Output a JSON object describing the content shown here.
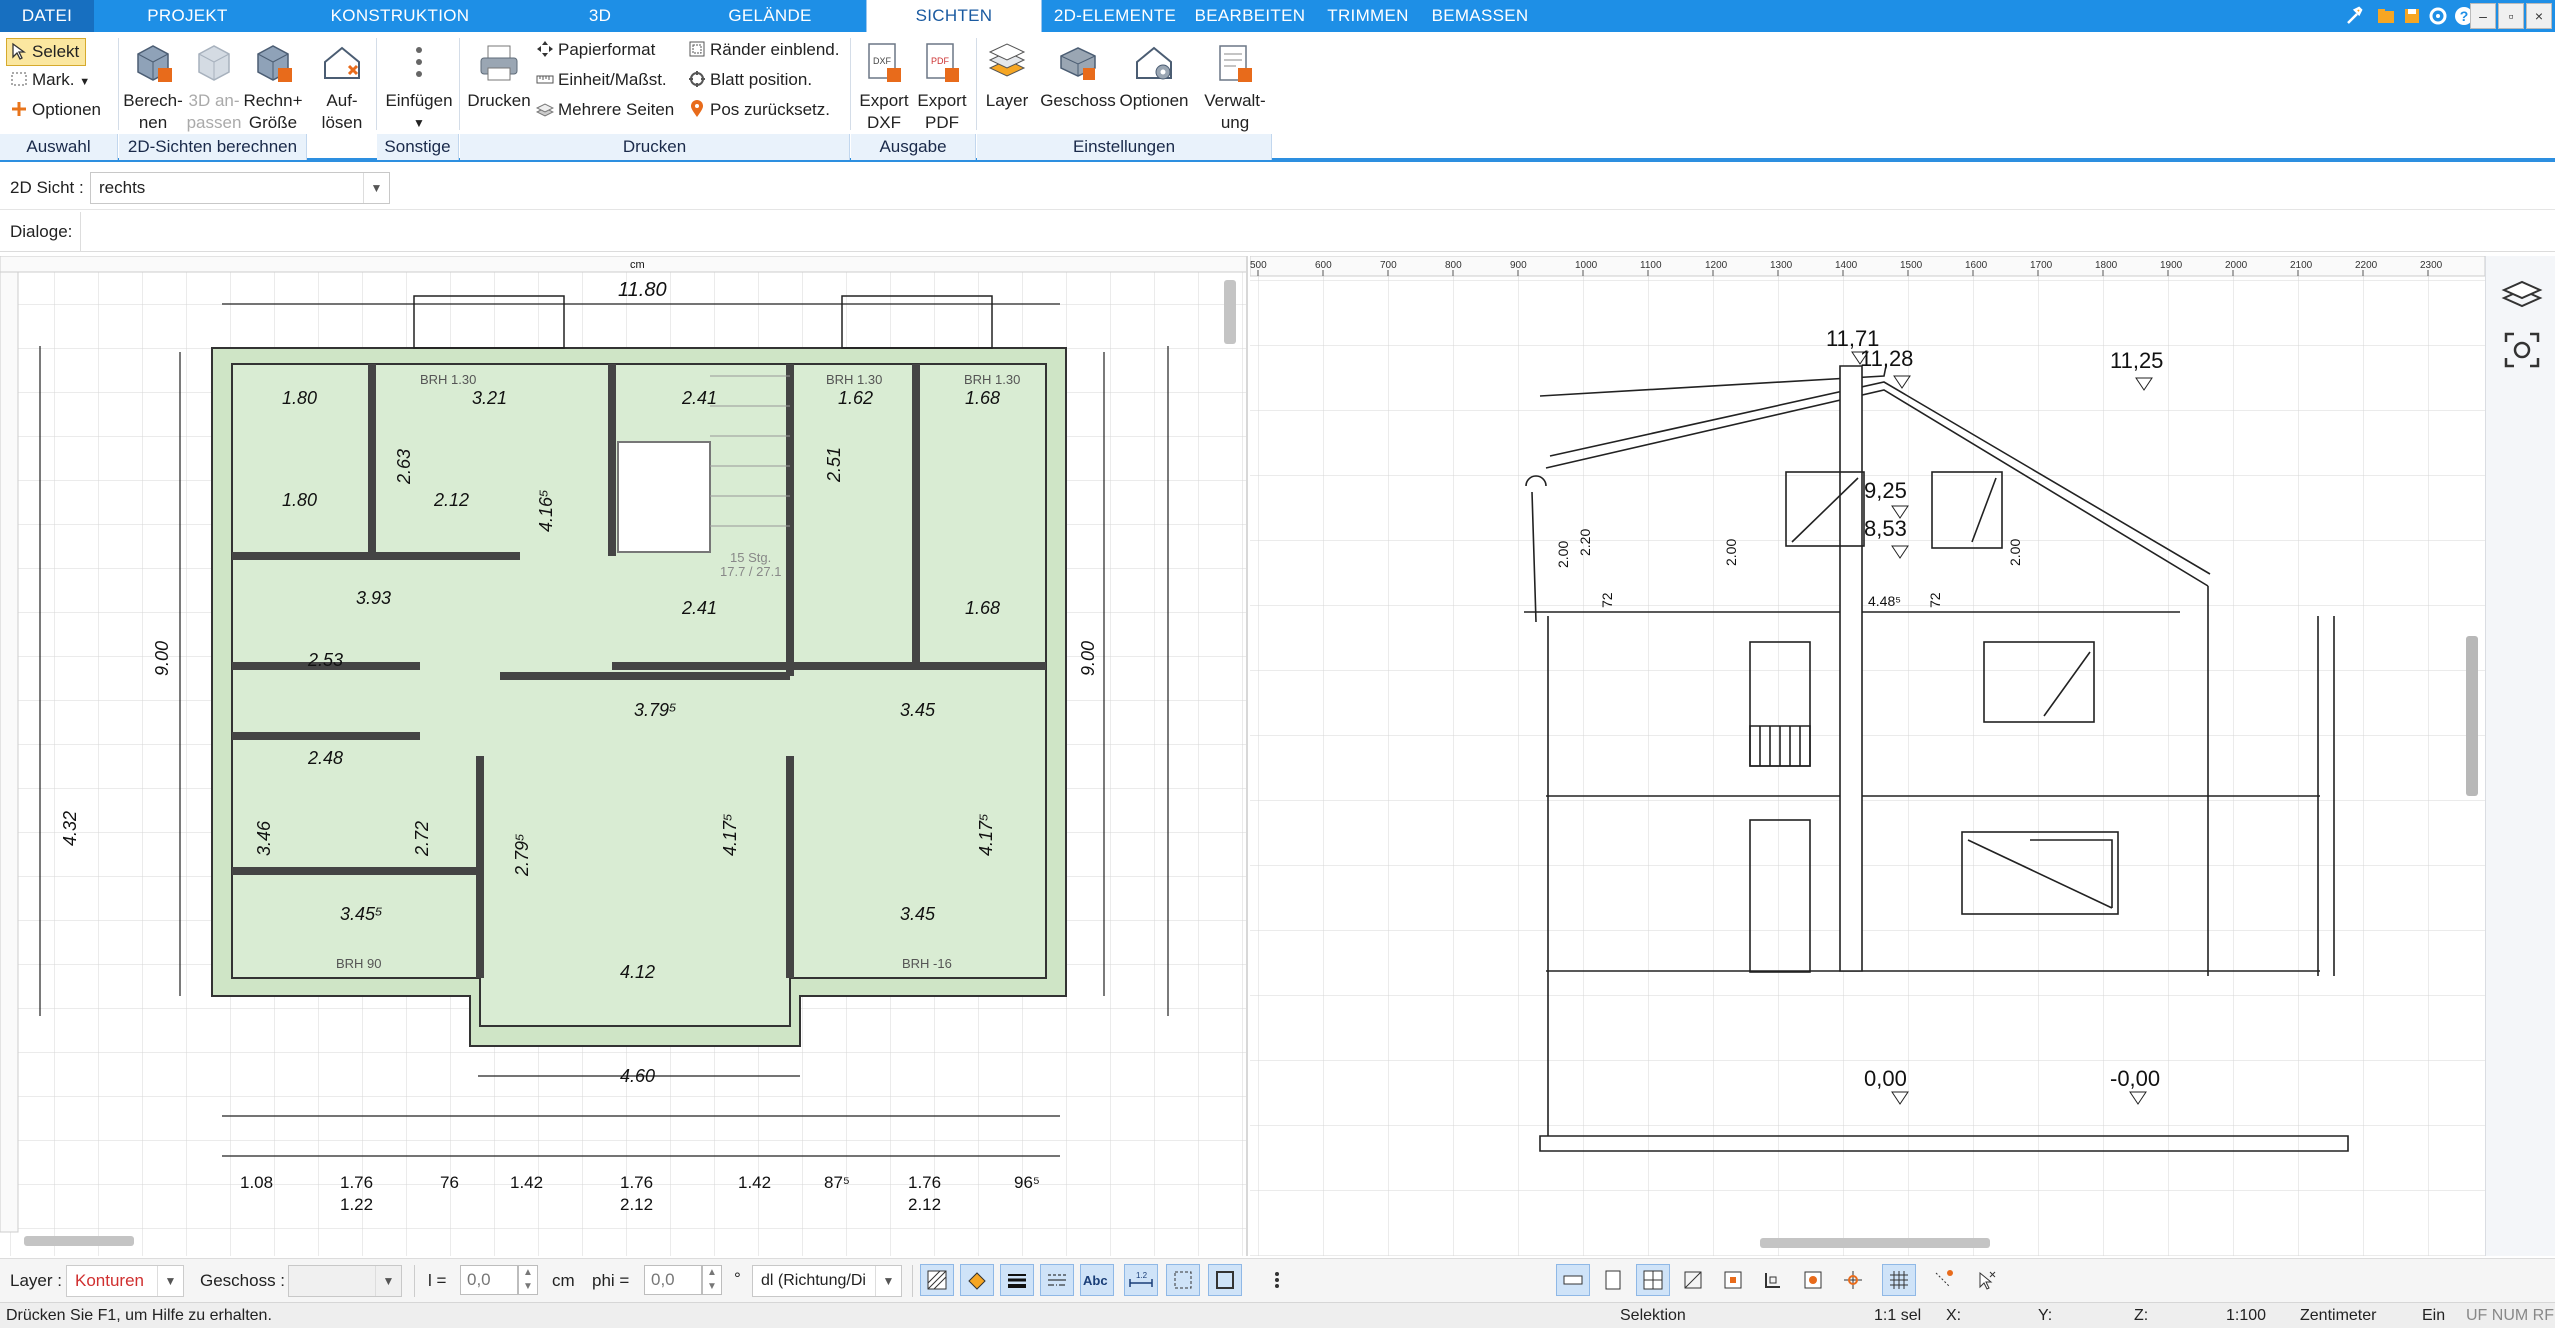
{
  "menu": {
    "tabs": [
      "DATEI",
      "PROJEKT",
      "KONSTRUKTION",
      "3D",
      "GELÄNDE",
      "SICHTEN",
      "2D-ELEMENTE",
      "BEARBEITEN",
      "TRIMMEN",
      "BEMASSEN"
    ],
    "active_tab": "SICHTEN"
  },
  "ribbon": {
    "auswahl": {
      "selekt": "Selekt",
      "mark": "Mark.",
      "optionen": "Optionen",
      "label": "Auswahl"
    },
    "sichten": {
      "berechnen": [
        "Berech-",
        "nen"
      ],
      "anpassen": [
        "3D an-",
        "passen"
      ],
      "rechn_groesse": [
        "Rechn+",
        "Größe"
      ],
      "label": "2D-Sichten berechnen"
    },
    "aufloesen": [
      "Auf-",
      "lösen"
    ],
    "sonstige": {
      "einfuegen": "Einfügen",
      "label": "Sonstige"
    },
    "drucken": {
      "drucken": "Drucken",
      "papierformat": "Papierformat",
      "einheit": "Einheit/Maßst.",
      "mehrere": "Mehrere Seiten",
      "raender": "Ränder einblend.",
      "blatt": "Blatt position.",
      "pos": "Pos zurücksetz.",
      "label": "Drucken"
    },
    "ausgabe": {
      "dxf": [
        "Export",
        "DXF"
      ],
      "pdf": [
        "Export",
        "PDF"
      ],
      "label": "Ausgabe"
    },
    "einstellungen": {
      "layer": "Layer",
      "geschoss": "Geschoss",
      "optionen": "Optionen",
      "verwaltung": [
        "Verwalt-",
        "ung"
      ],
      "label": "Einstellungen"
    }
  },
  "sicht": {
    "label": "2D Sicht :",
    "value": "rechts"
  },
  "dialoge": {
    "label": "Dialoge:"
  },
  "floorplan": {
    "unit": "cm",
    "dims_top": [
      "11.80"
    ],
    "dims_bottom": [
      "1.08",
      "1.76",
      "76",
      "1.42",
      "1.76",
      "1.42",
      "87⁵",
      "1.76",
      "96⁵"
    ],
    "dims_bottom2": [
      "1.22",
      "2.12",
      "2.12"
    ],
    "room_dims": [
      "1.80",
      "3.21",
      "2.41",
      "1.62",
      "1.68",
      "2.63",
      "1.80",
      "2.12",
      "4.16⁵",
      "2.51",
      "3.93",
      "2.41",
      "1.68",
      "2.53",
      "3.79⁵",
      "3.45",
      "2.48",
      "3.46",
      "2.72",
      "2.79⁵",
      "4.17⁵",
      "3.45⁵",
      "3.45",
      "4.12",
      "9.00",
      "4.32",
      "4.60"
    ],
    "labels": [
      "BRH 1.30",
      "BRH 1.30",
      "BRH 1.30",
      "BRH 90",
      "BRH -16",
      "15 Stg.",
      "17.7 / 27.1"
    ]
  },
  "elevation": {
    "levels": [
      "11,71",
      "11,28",
      "11,25",
      "9,25",
      "8,53",
      "0,00",
      "-0,00"
    ],
    "dims": [
      "2.00",
      "2.20",
      "72",
      "2.00",
      "2.00",
      "4.48⁵",
      "72"
    ],
    "ruler": [
      "500",
      "600",
      "700",
      "800",
      "900",
      "1000",
      "1100",
      "1200",
      "1300",
      "1400",
      "1500",
      "1600",
      "1700",
      "1800",
      "1900",
      "2000",
      "2100",
      "2200",
      "2300"
    ]
  },
  "layerbar": {
    "layer_label": "Layer :",
    "layer_value": "Konturen",
    "geschoss_label": "Geschoss :",
    "l_label": "l =",
    "l_value": "0,0",
    "l_unit": "cm",
    "phi_label": "phi =",
    "phi_value": "0,0",
    "phi_unit": "°",
    "mode_value": "dl (Richtung/Di"
  },
  "status": {
    "help": "Drücken Sie F1, um Hilfe zu erhalten.",
    "mode": "Selektion",
    "scale_sel": "1:1 sel",
    "x": "X:",
    "y": "Y:",
    "z": "Z:",
    "scale": "1:100",
    "unit": "Zentimeter",
    "ein": "Ein",
    "flags": "UF NUM RF"
  },
  "colors": {
    "accent": "#1e8fe6",
    "plan_fill": "#d9ecd3",
    "layer_value": "#d03030"
  }
}
